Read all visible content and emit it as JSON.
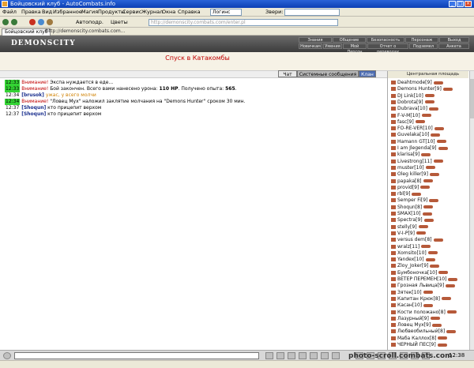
{
  "window": {
    "title": "Бойцовский клуб - AutoCombats.info"
  },
  "menu": [
    "Файл",
    "Правка",
    "Вид",
    "Избранное",
    "Магия",
    "Продукты",
    "Сервис",
    "Журнал",
    "Окна",
    "Справка"
  ],
  "menu_fields": {
    "left": "Логинс",
    "right": "Звери:"
  },
  "toolbar": {
    "address": "http://demonscity.combats.com/enter.pl",
    "autodetect": "Автоподр.",
    "contacts": "Цветы"
  },
  "tab": {
    "label": "Бойцовский клуб",
    "url": "http://demonscity.combats.com..."
  },
  "game": {
    "logo": "DEMONSCITY"
  },
  "topnav": [
    "Знания",
    "Общение",
    "Безопасность",
    "Персонаж",
    "Выход",
    "Новичкам",
    "Умения",
    "Мой Персон",
    "Отчет о переводах",
    "Подземел",
    "Анкета"
  ],
  "location": {
    "title": "Спуск в Катакомбы"
  },
  "chat_tabs": {
    "chat": "Чат",
    "system": "Системные сообщения",
    "clan": "Клан"
  },
  "chat": [
    {
      "time": "12:33",
      "green": true,
      "tag": "Внимание!",
      "text": " Экспа нуждается в еде..."
    },
    {
      "time": "12:33",
      "green": true,
      "tag": "Внимание!",
      "text": " Бой закончен. Всего вами нанесено урона: ",
      "b1": "110 HP",
      "text2": ". Получено опыта: ",
      "b2": "565",
      "text3": "."
    },
    {
      "time": "12:34",
      "green": false,
      "who": "[brusok]",
      "text": " ужас, у всего молчи"
    },
    {
      "time": "12:34",
      "green": true,
      "tag": "Внимание!",
      "text": " \"Ловец Мух\" наложил заклятие молчания на \"Demons Hunter\" сроком 30 мин."
    },
    {
      "time": "12:37",
      "green": false,
      "who": "[Shoqun]",
      "text": " кто прицепит верхом"
    },
    {
      "time": "12:37",
      "green": false,
      "who": "[Shoqun]",
      "text": " кто прицепит верхом"
    }
  ],
  "online": {
    "header": "Центральная площадь",
    "users": [
      "Deahtmode[9]",
      "Demons Hunter[9]",
      "DJ Link[10]",
      "Dobrota[9]",
      "Dubrava[10]",
      "F-V-M[10]",
      "fasc[9]",
      "FO-RE-VER[10]",
      "Guvelaka[10]",
      "Hamann GT[10]",
      "I am Jlegenda[9]",
      "klarisa[9]",
      "Livestrong[11]",
      "muster[10]",
      "Oleg killer[9]",
      "papaka[8]",
      "provid[9]",
      "rbl[9]",
      "Semper Fi[9]",
      "Shoqun[8]",
      "SMAX[10]",
      "Spectra[9]",
      "stelly[9]",
      "V-I-P[9]",
      "versus dem[8]",
      "wralz[11]",
      "Xomsito[10]",
      "Yandex[10]",
      "Zloy_Joker[9]",
      "Бумбоночка[10]",
      "ВЕТЕР ПЕРЕМЕН[10]",
      "Грозная Львица[9]",
      "Зятек[10]",
      "Капитан Крюк[8]",
      "Касан[10]",
      "Кости положано[8]",
      "Лазурный[9]",
      "Ловец Мух[9]",
      "Любвеобильный[8]",
      "Маба Каллох[8]",
      "ЧЕРНЫЙ ПЕС[9]"
    ]
  },
  "clock": "12:38",
  "watermark": "photo-scroll.combats.com"
}
